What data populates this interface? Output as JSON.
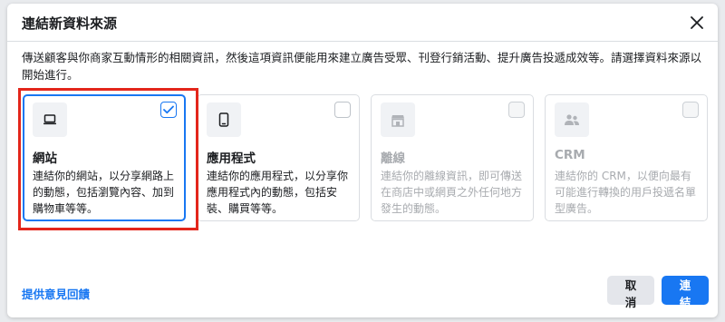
{
  "dialog": {
    "title": "連結新資料來源",
    "description": "傳送顧客與你商家互動情形的相關資訊，然後這項資訊便能用來建立廣告受眾、刊登行銷活動、提升廣告投遞成效等。請選擇資料來源以開始進行。"
  },
  "cards": [
    {
      "icon": "laptop-icon",
      "title": "網站",
      "description": "連結你的網站，以分享網路上的動態，包括瀏覽內容、加到購物車等等。",
      "selected": true,
      "disabled": false
    },
    {
      "icon": "phone-icon",
      "title": "應用程式",
      "description": "連結你的應用程式，以分享你應用程式內的動態，包括安裝、購買等等。",
      "selected": false,
      "disabled": false
    },
    {
      "icon": "store-icon",
      "title": "離線",
      "description": "連結你的離線資訊，即可傳送在商店中或網頁之外任何地方發生的動態。",
      "selected": false,
      "disabled": true
    },
    {
      "icon": "people-icon",
      "title": "CRM",
      "description": "連結你的 CRM，以便向最有可能進行轉換的用戶投遞名單型廣告。",
      "selected": false,
      "disabled": true
    }
  ],
  "footer": {
    "feedback_label": "提供意見回饋",
    "cancel_label": "取消",
    "connect_label": "連結"
  },
  "colors": {
    "primary": "#1877f2",
    "highlight": "#e3261b",
    "disabled_text": "#a8abaf"
  }
}
